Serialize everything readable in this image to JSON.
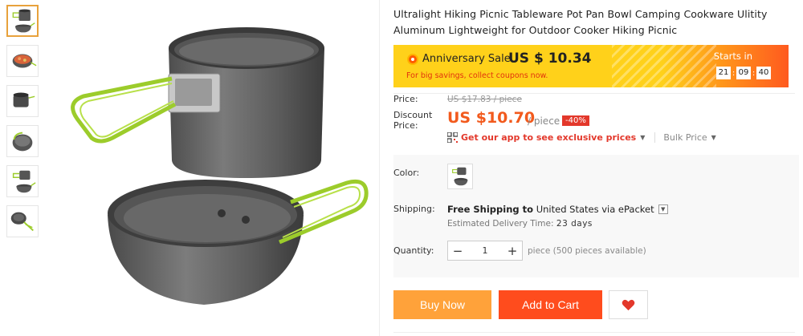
{
  "product": {
    "title": "Ultralight Hiking Picnic Tableware Pot Pan Bowl Camping Cookware Ulitity Aluminum Lightweight for Outdoor Cooker Hiking Picnic"
  },
  "thumbnails": [
    {
      "icon": "pot-pan-set-thumbnail",
      "active": true
    },
    {
      "icon": "pot-with-food-thumbnail",
      "active": false
    },
    {
      "icon": "pot-pan-side-thumbnail",
      "active": false
    },
    {
      "icon": "pot-tilted-thumbnail",
      "active": false
    },
    {
      "icon": "pot-pan-angle-thumbnail",
      "active": false
    },
    {
      "icon": "pan-handle-thumbnail",
      "active": false
    }
  ],
  "banner": {
    "sale_label": "Anniversary Sale",
    "sale_price": "US $ 10.34",
    "subtext": "For big savings, collect coupons now.",
    "starts_label": "Starts in",
    "timer": {
      "hours": "21",
      "minutes": "09",
      "seconds": "40"
    },
    "colors": {
      "yellow": "#ffd11a",
      "orange": "#ff5a1f"
    }
  },
  "pricing": {
    "price_label": "Price:",
    "original_price": "US $17.83 / piece",
    "discount_label": "Discount Price:",
    "discount_label_line1": "Discount",
    "discount_label_line2": "Price:",
    "discount_price": "US $10.70",
    "unit": "/ piece",
    "discount_badge": "-40%",
    "app_promo": "Get our app to see exclusive prices",
    "bulk_price": "Bulk Price"
  },
  "options": {
    "color_label": "Color:",
    "shipping_label": "Shipping:",
    "shipping_prefix": "Free Shipping to",
    "shipping_dest": "United States via ePacket",
    "eta_label": "Estimated Delivery Time:",
    "eta_value": "23 days",
    "quantity_label": "Quantity:",
    "quantity_value": "1",
    "quantity_minus": "−",
    "quantity_plus": "+",
    "availability": "piece (500 pieces available)"
  },
  "actions": {
    "buy_now": "Buy Now",
    "add_to_cart": "Add to Cart",
    "wishlist_icon": "heart-icon"
  },
  "colors": {
    "accent": "#f25a1d",
    "buy_now": "#ffa23a",
    "add_to_cart": "#ff4c1d",
    "badge": "#e3382b"
  }
}
